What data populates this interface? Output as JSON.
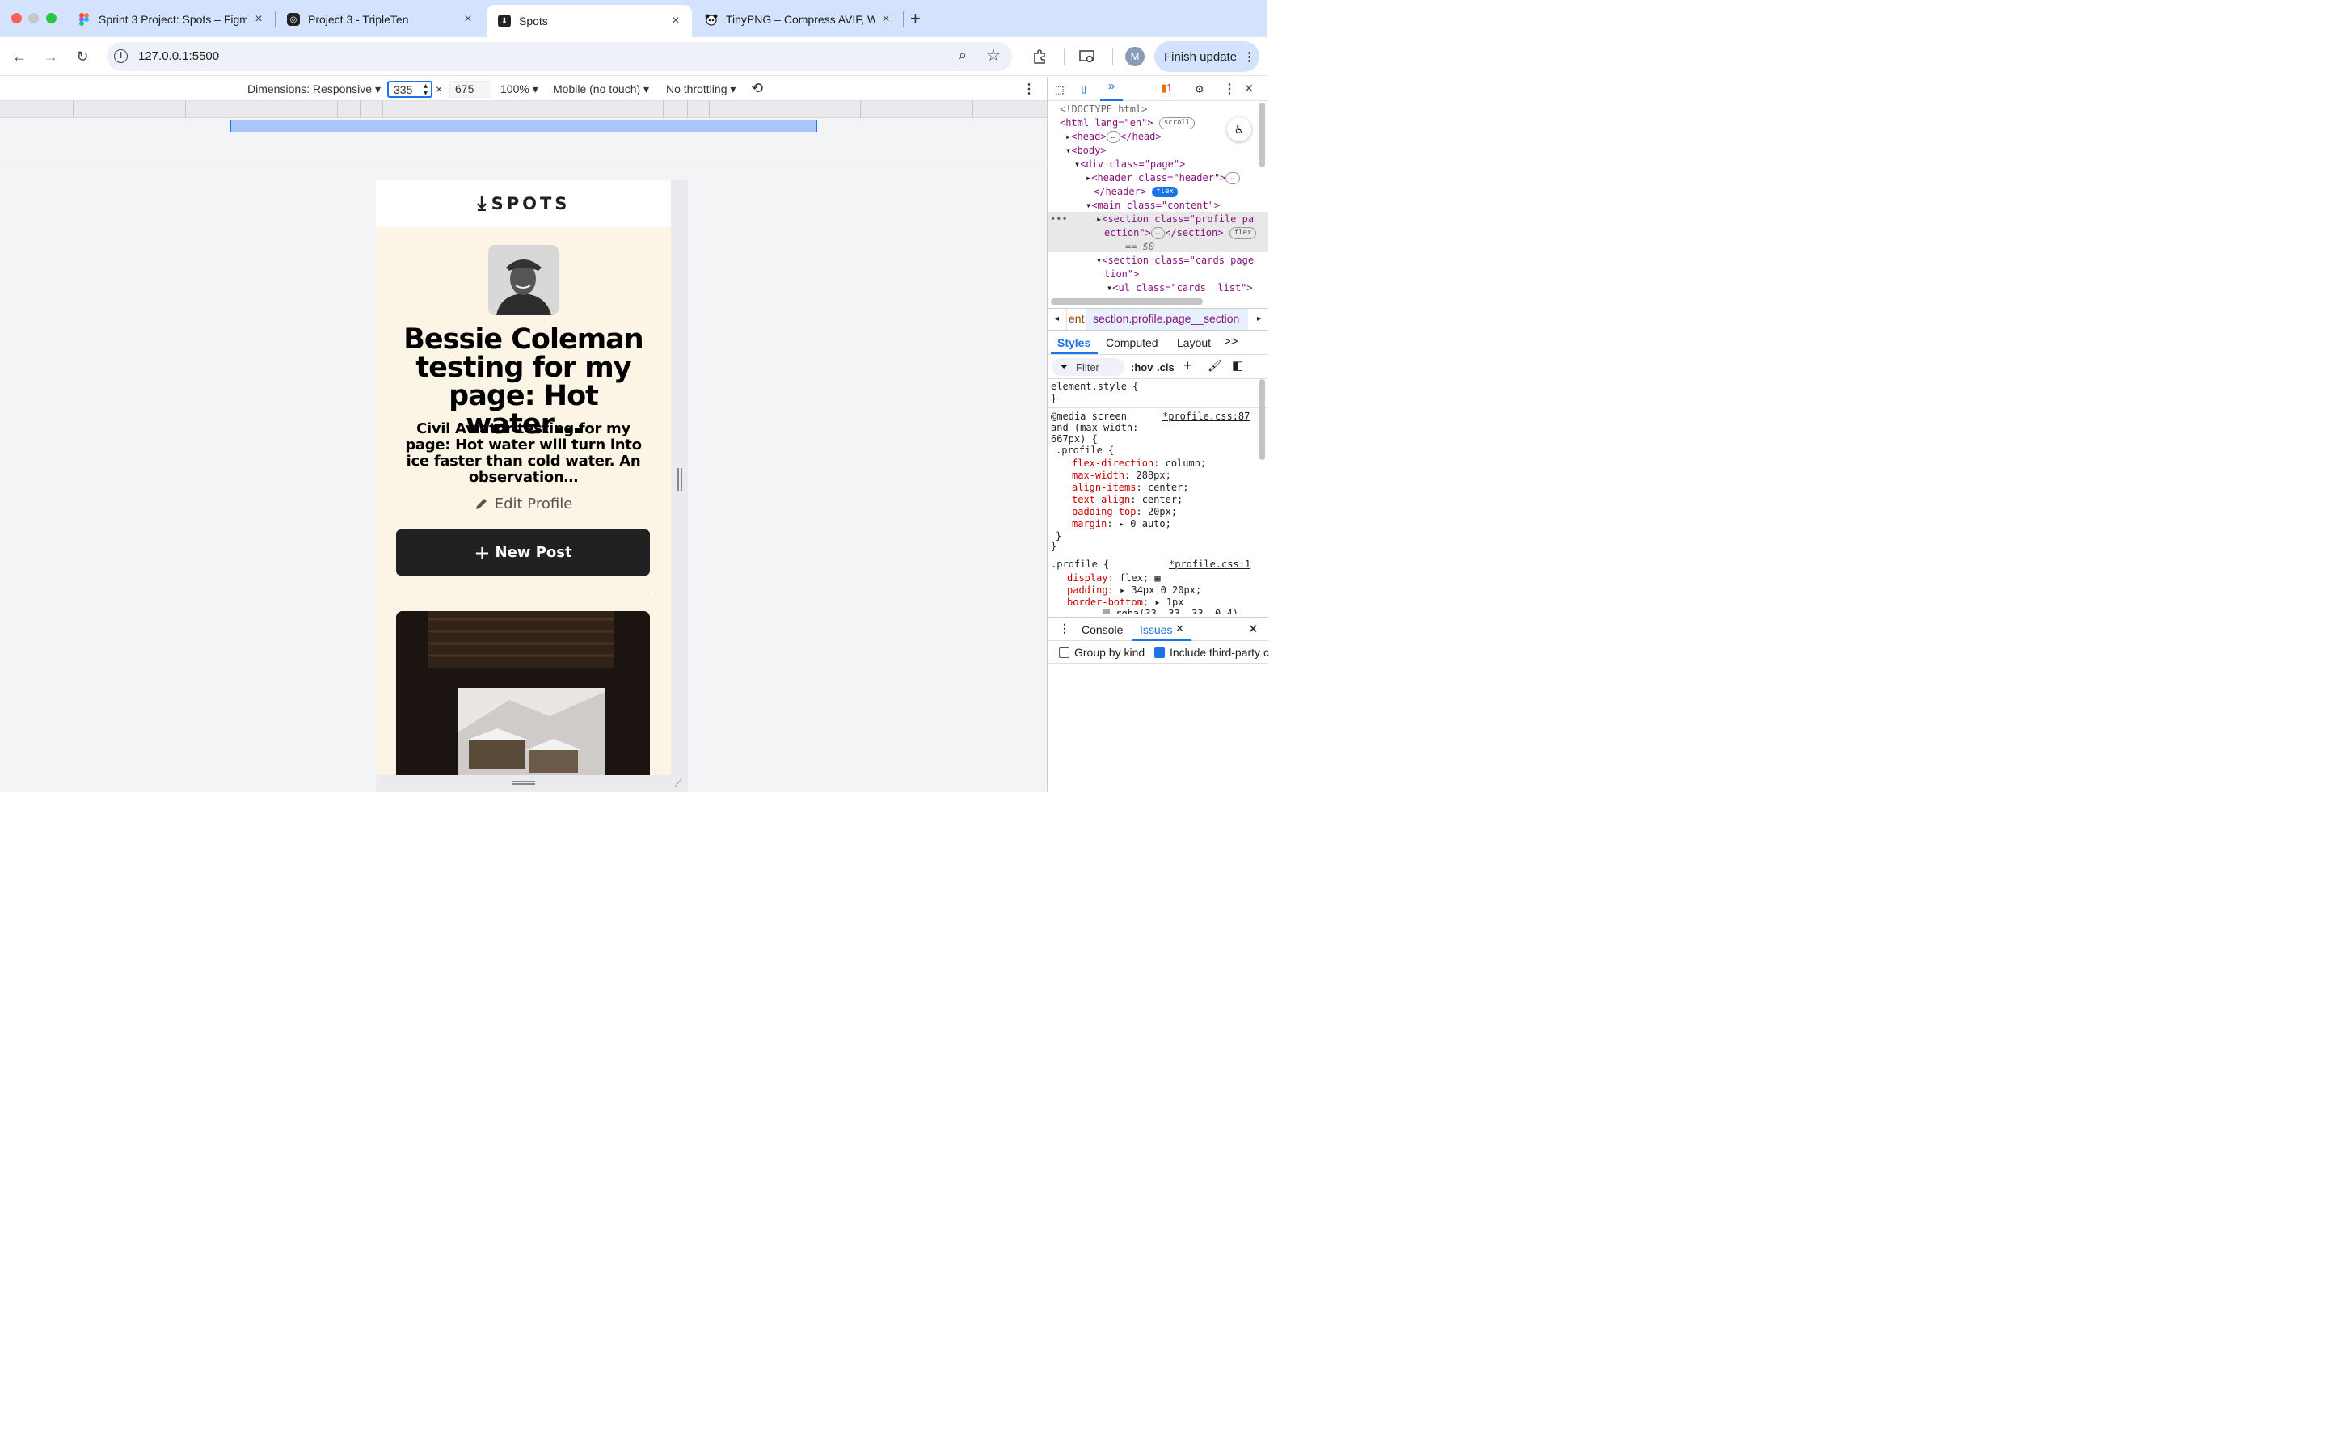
{
  "tabs": [
    {
      "title": "Sprint 3 Project: Spots – Figm",
      "favicon": "figma-icon",
      "close": "×"
    },
    {
      "title": "Project 3 - TripleTen",
      "favicon": "tripleten-icon",
      "close": "×"
    },
    {
      "title": "Spots",
      "favicon": "spots-icon",
      "close": "×",
      "active": true
    },
    {
      "title": "TinyPNG – Compress AVIF, W",
      "favicon": "panda-icon",
      "close": "×"
    }
  ],
  "new_tab": "+",
  "toolbar": {
    "url": "127.0.0.1:5500",
    "avatar_letter": "M",
    "finish_update": "Finish update"
  },
  "devbar": {
    "dimensions_label": "Dimensions: Responsive",
    "width": "335",
    "times": "×",
    "height": "675",
    "zoom": "100%",
    "device": "Mobile (no touch)",
    "throttling": "No throttling"
  },
  "page": {
    "logo": "SPOTS",
    "profile_name": "Bessie Coleman testing for my page: Hot water…",
    "profile_description": "Civil Aviator testing for my page: Hot water will turn into ice faster than cold water. An observation…",
    "edit_profile": "Edit Profile",
    "new_post": "New Post",
    "new_post_plus": "+"
  },
  "devtools": {
    "issues_count": "1",
    "dom": {
      "doctype": "<!DOCTYPE html>",
      "html_open": "<html lang=\"en\">",
      "scroll_badge": "scroll",
      "head": "<head>",
      "head_close": "</head>",
      "body": "<body>",
      "div_page": "<div class=\"page\">",
      "header": "<header class=\"header\">",
      "header_close": "</header>",
      "flex_badge": "flex",
      "main": "<main class=\"content\">",
      "section_profile_1": "<section class=\"profile pa",
      "section_profile_2": "ection\">",
      "section_close": "</section>",
      "eq": "== $0",
      "section_cards_1": "<section class=\"cards page",
      "section_cards_2": "tion\">",
      "ul": "<ul class=\"cards__list\">",
      "ellipsis": "•••"
    },
    "breadcrumb": {
      "prev": "ent",
      "current": "section.profile.page__section"
    },
    "sub_tabs": [
      "Styles",
      "Computed",
      "Layout"
    ],
    "more": ">>",
    "filter": {
      "label": "Filter",
      "hov": ":hov",
      "cls": ".cls"
    },
    "styles": {
      "element_style": "element.style {",
      "close_brace": "}",
      "media_1": "@media screen",
      "media_link": "*profile.css:87",
      "media_2": "and (max-width:",
      "media_3": "667px) {",
      "rule_selector": ".profile {",
      "props": [
        {
          "name": "flex-direction",
          "value": "column;"
        },
        {
          "name": "max-width",
          "value": "288px;"
        },
        {
          "name": "align-items",
          "value": "center;"
        },
        {
          "name": "text-align",
          "value": "center;"
        },
        {
          "name": "padding-top",
          "value": "20px;"
        },
        {
          "name": "margin",
          "value": "0 auto;"
        }
      ],
      "rule2_selector": ".profile {",
      "rule2_link": "*profile.css:1",
      "props2": [
        {
          "name": "display",
          "value": "flex;"
        },
        {
          "name": "padding",
          "value": "34px 0 20px;"
        },
        {
          "name": "border-bottom",
          "value": "1px"
        }
      ],
      "rgba": "rgba(33, 33, 33, 0.4)"
    },
    "drawer": {
      "console": "Console",
      "issues": "Issues",
      "group_by_kind": "Group by kind",
      "include_third": "Include third-party c"
    }
  },
  "colors": {
    "accent": "#1a73e8",
    "page_bg": "#fcf5e5",
    "button": "#212121",
    "tab_strip": "#d3e3fd"
  }
}
